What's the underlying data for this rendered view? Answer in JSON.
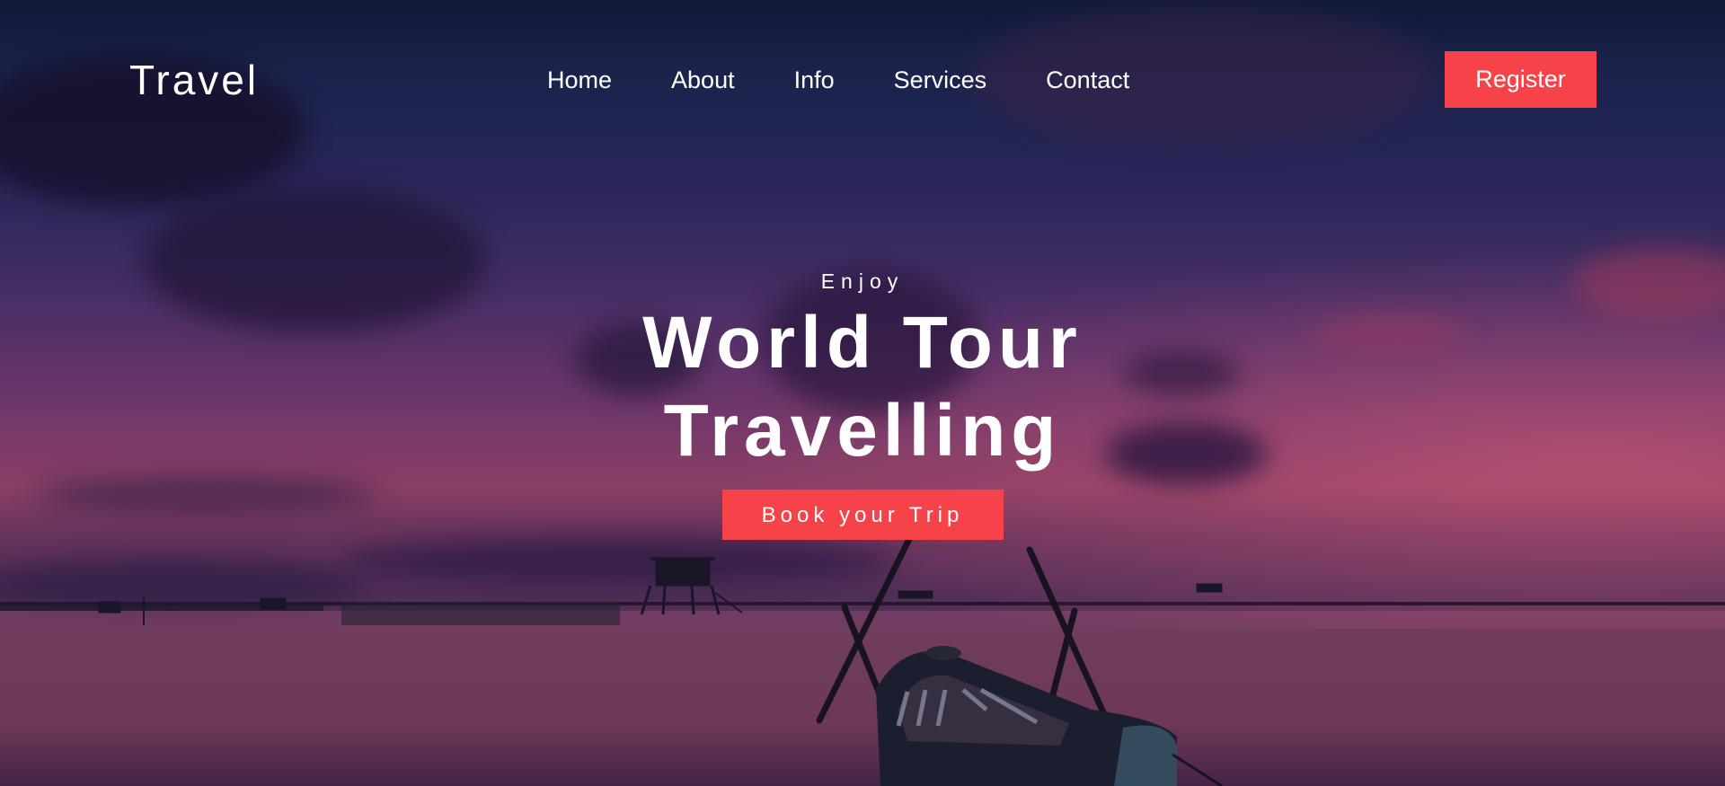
{
  "brand": {
    "logo_text": "Travel"
  },
  "nav": {
    "items": [
      {
        "label": "Home"
      },
      {
        "label": "About"
      },
      {
        "label": "Info"
      },
      {
        "label": "Services"
      },
      {
        "label": "Contact"
      }
    ],
    "register_label": "Register"
  },
  "hero": {
    "eyebrow": "Enjoy",
    "headline_line1": "World Tour",
    "headline_line2": "Travelling",
    "cta_label": "Book your Trip"
  },
  "colors": {
    "accent": "#f64349",
    "text": "#ffffff"
  }
}
